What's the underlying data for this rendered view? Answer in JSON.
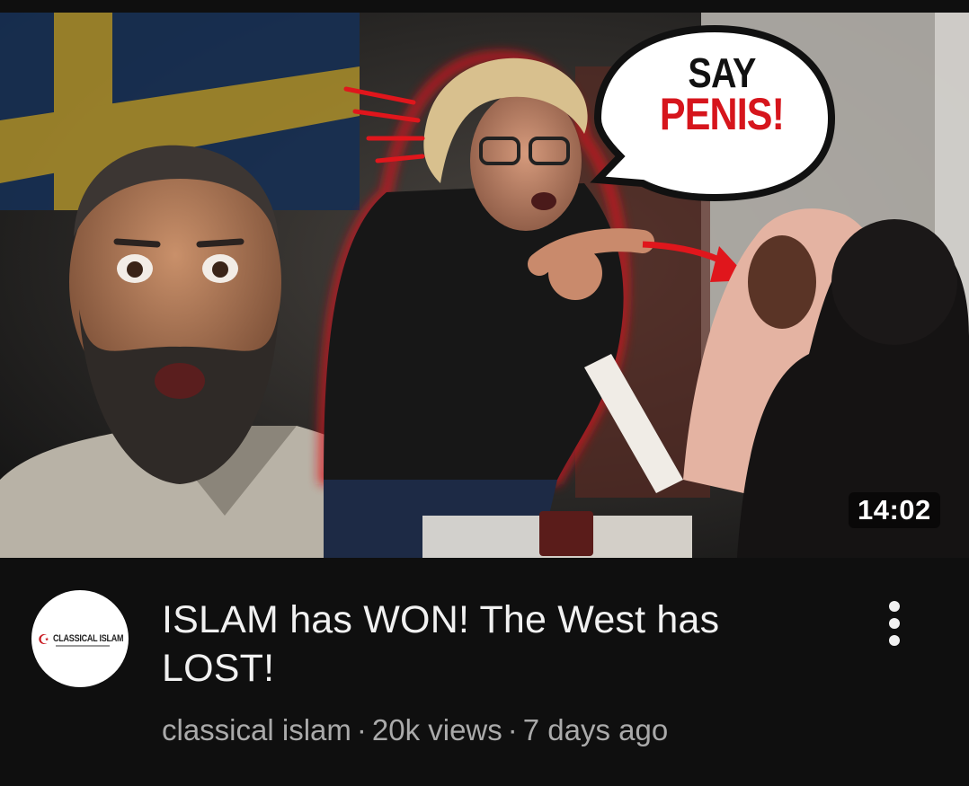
{
  "thumbnail": {
    "speech_bubble_line1": "SAY",
    "speech_bubble_line2": "PENIS!",
    "duration": "14:02",
    "accent_red": "#d6151c",
    "flag_blue": "#1f3f6e",
    "flag_yellow": "#d7b43a"
  },
  "channel": {
    "avatar_logo_text": "CLASSICAL ISLAM",
    "avatar_icon": "crescent-star-icon"
  },
  "video": {
    "title": "ISLAM has WON! The West has LOST!",
    "channel_name": "classical islam",
    "separator": "·",
    "views": "20k views",
    "age": "7 days ago"
  },
  "actions": {
    "more_icon": "vertical-ellipsis-icon"
  },
  "theme": {
    "background": "#0f0f0f",
    "title_color": "#f1f1f1",
    "meta_color": "#aaaaaa"
  }
}
